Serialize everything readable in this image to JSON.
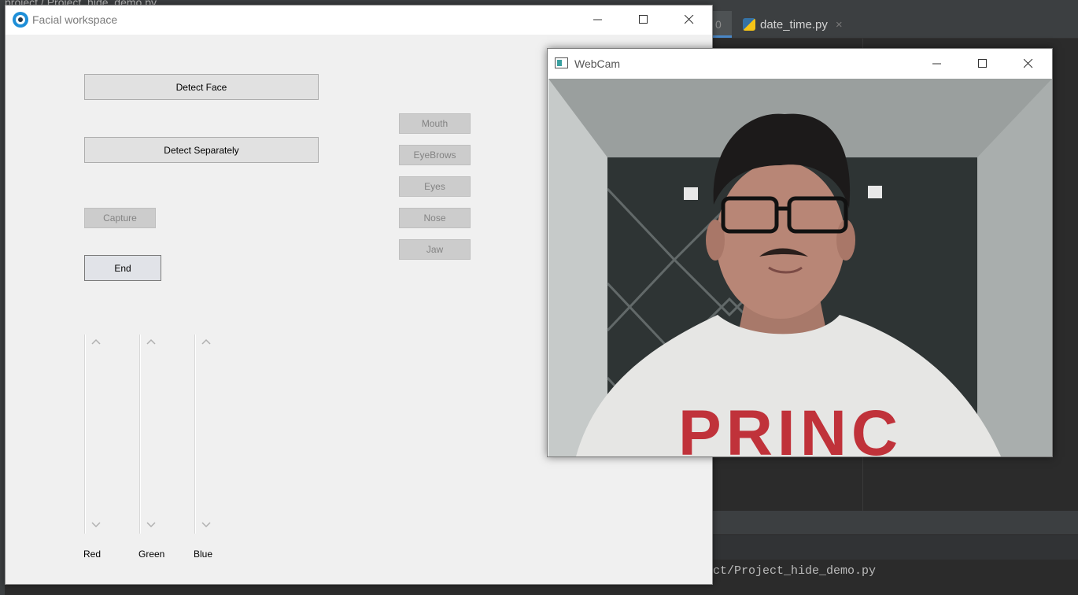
{
  "ide": {
    "breadcrumb": "project  /  Project_hide_demo.py",
    "tab_partial_label": "0",
    "tab_label": "date_time.py",
    "tab_close": "×",
    "console_line": "ct/Project_hide_demo.py"
  },
  "main_window": {
    "title": "Facial workspace",
    "buttons": {
      "detect_face": "Detect Face",
      "detect_separately": "Detect Separately",
      "capture": "Capture",
      "end": "End"
    },
    "feature_buttons": [
      "Mouth",
      "EyeBrows",
      "Eyes",
      "Nose",
      "Jaw"
    ],
    "sliders": [
      {
        "label": "Red"
      },
      {
        "label": "Green"
      },
      {
        "label": "Blue"
      }
    ]
  },
  "webcam_window": {
    "title": "WebCam",
    "shirt_text": "PRINC"
  },
  "colors": {
    "accent": "#1f8fd8",
    "ide_bg": "#2b2b2b",
    "window_bg": "#f0f0f0",
    "shirt_print": "#c0323a"
  }
}
